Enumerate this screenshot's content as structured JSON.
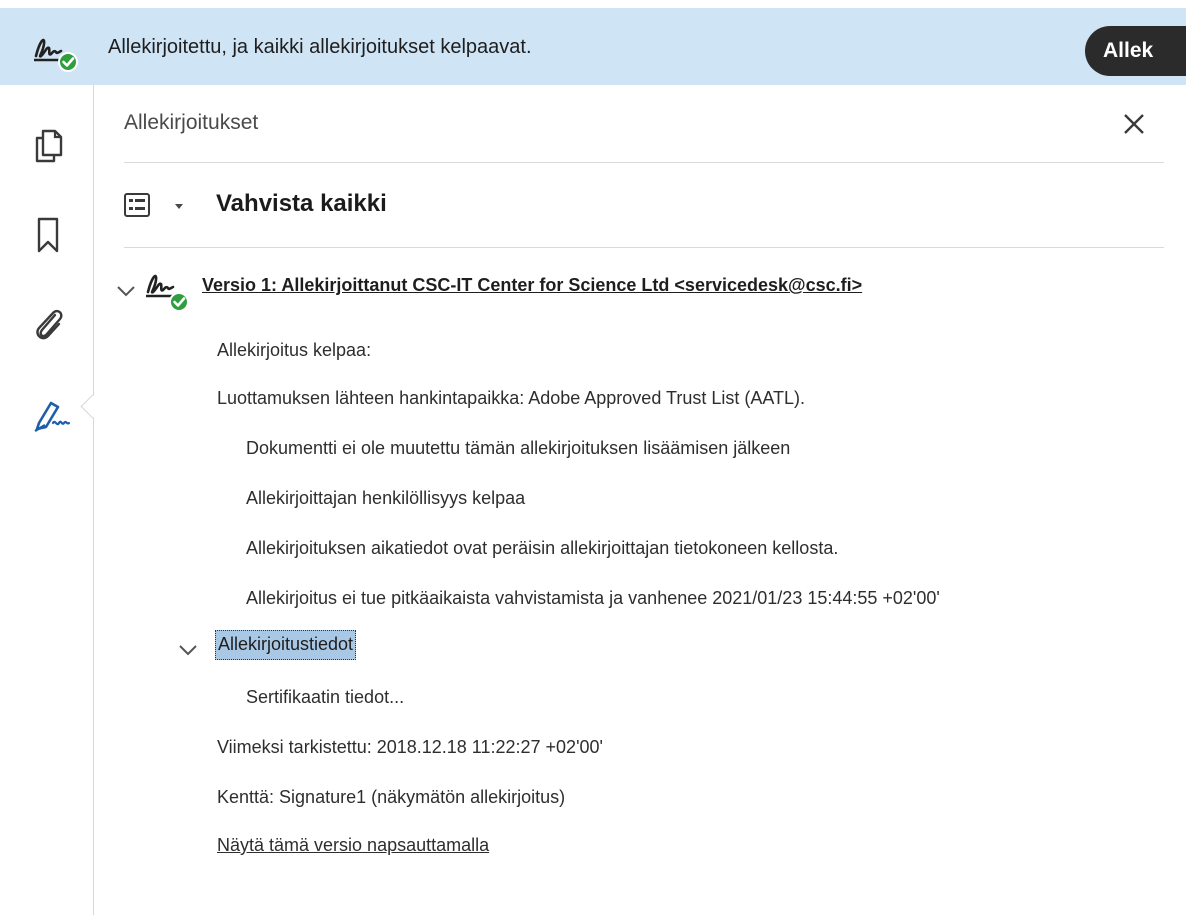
{
  "banner": {
    "text": "Allekirjoitettu, ja kaikki allekirjoitukset kelpaavat.",
    "button_label": "Allek",
    "icon": "signature-valid-icon"
  },
  "rail": {
    "items": [
      {
        "icon": "copy-pages-icon"
      },
      {
        "icon": "bookmark-icon"
      },
      {
        "icon": "attachment-icon"
      },
      {
        "icon": "signature-pen-icon"
      }
    ]
  },
  "panel": {
    "title": "Allekirjoitukset",
    "verify_all_label": "Vahvista kaikki",
    "version": {
      "label": "Versio 1: Allekirjoittanut CSC-IT Center for Science Ltd <servicedesk@csc.fi>",
      "status_lines": [
        "Allekirjoitus kelpaa:",
        "Luottamuksen lähteen hankintapaikka: Adobe Approved Trust List (AATL)."
      ],
      "detail_lines": [
        "Dokumentti ei ole muutettu tämän allekirjoituksen lisäämisen jälkeen",
        "Allekirjoittajan henkilöllisyys kelpaa",
        "Allekirjoituksen aikatiedot ovat peräisin allekirjoittajan tietokoneen kellosta.",
        "Allekirjoitus ei tue pitkäaikaista vahvistamista ja vanhenee 2021/01/23 15:44:55 +02'00'"
      ],
      "signature_details_label": "Allekirjoitustiedot",
      "certificate_details_label": "Sertifikaatin tiedot...",
      "last_checked": "Viimeksi tarkistettu: 2018.12.18 11:22:27 +02'00'",
      "field": "Kenttä: Signature1 (näkymätön allekirjoitus)",
      "show_version_link": "Näytä tämä versio napsauttamalla"
    }
  },
  "colors": {
    "banner_bg": "#cfe4f5",
    "valid_green": "#2e9e3e",
    "selection": "#a9c8e6",
    "accent_blue": "#1f5fa8"
  }
}
